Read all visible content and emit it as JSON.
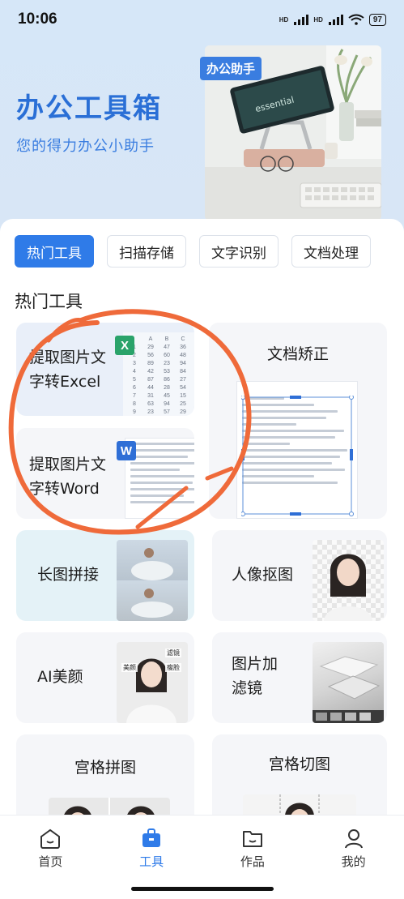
{
  "status_bar": {
    "time": "10:06",
    "battery": "97",
    "network_1": "HD",
    "network_2": "HD"
  },
  "hero": {
    "title": "办公工具箱",
    "subtitle": "您的得力办公小助手",
    "badge": "办公助手"
  },
  "tabs": [
    {
      "label": "热门工具",
      "active": true
    },
    {
      "label": "扫描存储",
      "active": false
    },
    {
      "label": "文字识别",
      "active": false
    },
    {
      "label": "文档处理",
      "active": false
    }
  ],
  "section_title": "热门工具",
  "tools": {
    "excel": {
      "label": "提取图片文字转Excel",
      "badge": "X"
    },
    "word": {
      "label": "提取图片文字转Word",
      "badge": "W"
    },
    "doc_correct": {
      "label": "文档矫正"
    },
    "long_stitch": {
      "label": "长图拼接"
    },
    "portrait_cutout": {
      "label": "人像抠图"
    },
    "ai_beauty": {
      "label": "AI美颜",
      "tags": [
        "美颜",
        "滤镜",
        "瘦脸"
      ]
    },
    "image_filter": {
      "label": "图片加滤镜"
    },
    "grid_collage": {
      "label": "宫格拼图"
    },
    "grid_cut": {
      "label": "宫格切图"
    }
  },
  "excel_preview": {
    "headers": [
      "A",
      "B",
      "C",
      "D"
    ],
    "rows": [
      [
        "1",
        "29",
        "47",
        "36",
        "26"
      ],
      [
        "2",
        "56",
        "60",
        "48",
        "53"
      ],
      [
        "3",
        "89",
        "23",
        "94",
        "36"
      ],
      [
        "4",
        "42",
        "53",
        "84",
        "37"
      ],
      [
        "5",
        "87",
        "86",
        "27",
        "36"
      ],
      [
        "6",
        "44",
        "28",
        "54",
        "21"
      ],
      [
        "7",
        "31",
        "45",
        "15",
        "39"
      ],
      [
        "8",
        "63",
        "94",
        "25",
        "55"
      ],
      [
        "9",
        "23",
        "57",
        "29",
        "37"
      ],
      [
        "10",
        "51",
        "45",
        "36",
        "47"
      ],
      [
        "11",
        "24",
        "27",
        "94",
        "23"
      ]
    ]
  },
  "nav": [
    {
      "label": "首页",
      "icon": "home-icon",
      "active": false
    },
    {
      "label": "工具",
      "icon": "toolbox-icon",
      "active": true
    },
    {
      "label": "作品",
      "icon": "folder-icon",
      "active": false
    },
    {
      "label": "我的",
      "icon": "profile-icon",
      "active": false
    }
  ],
  "colors": {
    "accent": "#2f7be8",
    "hero_title": "#2a6fd6",
    "annotation": "#ef6a3a",
    "excel": "#2aa36a",
    "word": "#2f6fd6"
  }
}
